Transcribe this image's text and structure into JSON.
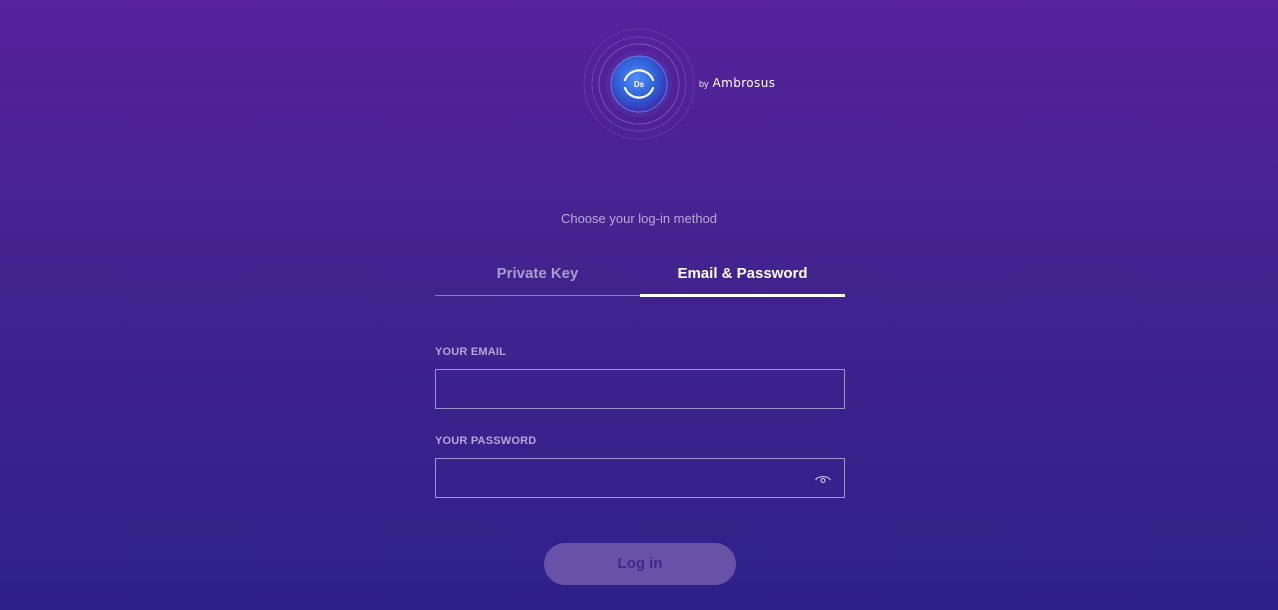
{
  "header": {
    "logo_text": "Ds",
    "by_text": "by",
    "brand_text": "Ambrosus"
  },
  "login": {
    "prompt": "Choose your log-in method",
    "tabs": [
      {
        "label": "Private Key",
        "active": false
      },
      {
        "label": "Email & Password",
        "active": true
      }
    ],
    "email": {
      "label": "YOUR EMAIL",
      "value": "",
      "placeholder": ""
    },
    "password": {
      "label": "YOUR PASSWORD",
      "value": "",
      "placeholder": "",
      "toggle_icon": "eye-icon"
    },
    "submit_label": "Log in"
  },
  "colors": {
    "background_top": "#57229c",
    "background_bottom": "#2f218a",
    "button_bg": "#6852a8",
    "button_text": "#3f2a8a",
    "logo_blue": "#3a6fe6"
  }
}
